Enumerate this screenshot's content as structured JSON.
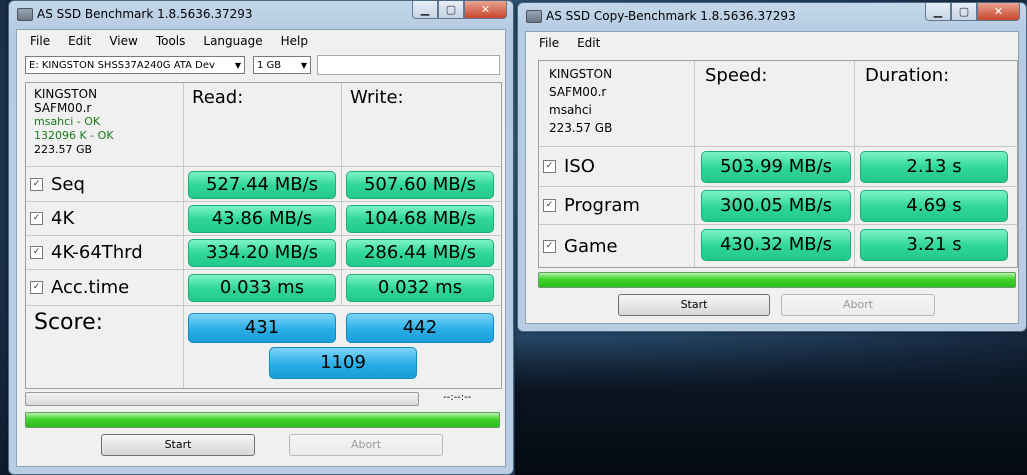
{
  "bench": {
    "title": "AS SSD Benchmark 1.8.5636.37293",
    "menu": [
      "File",
      "Edit",
      "View",
      "Tools",
      "Language",
      "Help"
    ],
    "drive_select": "E: KINGSTON SHSS37A240G ATA Dev",
    "size_select": "1 GB",
    "drive_info": {
      "model": "KINGSTON",
      "firmware": "SAFM00.r",
      "driver": "msahci - OK",
      "alignment": "132096 K - OK",
      "capacity": "223.57 GB"
    },
    "headers": {
      "read": "Read:",
      "write": "Write:"
    },
    "rows": [
      {
        "label": "Seq",
        "checked": true,
        "read": "527.44 MB/s",
        "write": "507.60 MB/s"
      },
      {
        "label": "4K",
        "checked": true,
        "read": "43.86 MB/s",
        "write": "104.68 MB/s"
      },
      {
        "label": "4K-64Thrd",
        "checked": true,
        "read": "334.20 MB/s",
        "write": "286.44 MB/s"
      },
      {
        "label": "Acc.time",
        "checked": true,
        "read": "0.033 ms",
        "write": "0.032 ms"
      }
    ],
    "score": {
      "label": "Score:",
      "read": "431",
      "write": "442",
      "total": "1109"
    },
    "timer": "--:--:--",
    "progress_overall": 1.0,
    "start_label": "Start",
    "abort_label": "Abort"
  },
  "copy": {
    "title": "AS SSD Copy-Benchmark 1.8.5636.37293",
    "menu": [
      "File",
      "Edit"
    ],
    "drive_info": {
      "model": "KINGSTON",
      "firmware": "SAFM00.r",
      "driver": "msahci",
      "capacity": "223.57 GB"
    },
    "headers": {
      "speed": "Speed:",
      "duration": "Duration:"
    },
    "rows": [
      {
        "label": "ISO",
        "checked": true,
        "speed": "503.99 MB/s",
        "duration": "2.13 s"
      },
      {
        "label": "Program",
        "checked": true,
        "speed": "300.05 MB/s",
        "duration": "4.69 s"
      },
      {
        "label": "Game",
        "checked": true,
        "speed": "430.32 MB/s",
        "duration": "3.21 s"
      }
    ],
    "progress": 1.0,
    "start_label": "Start",
    "abort_label": "Abort"
  },
  "colors": {
    "green": "#32d89a",
    "blue": "#29aee6",
    "progress": "#3fd12b"
  }
}
